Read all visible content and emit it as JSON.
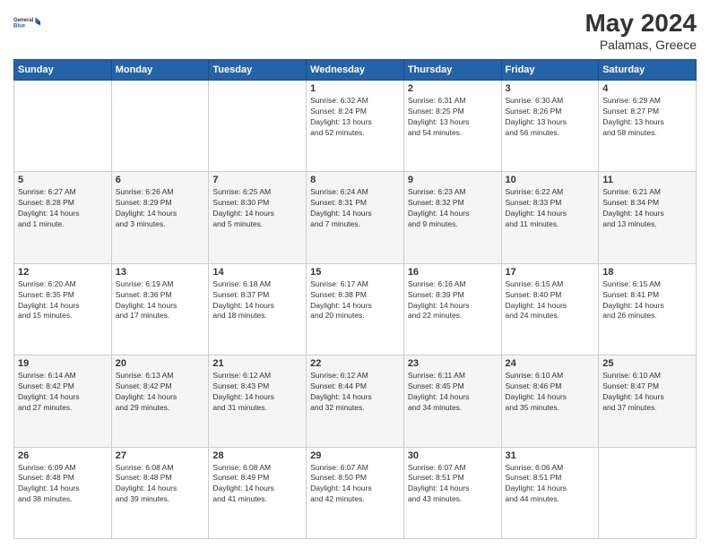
{
  "header": {
    "logo_line1": "General",
    "logo_line2": "Blue",
    "month_year": "May 2024",
    "location": "Palamas, Greece"
  },
  "weekdays": [
    "Sunday",
    "Monday",
    "Tuesday",
    "Wednesday",
    "Thursday",
    "Friday",
    "Saturday"
  ],
  "rows": [
    [
      {
        "day": "",
        "info": ""
      },
      {
        "day": "",
        "info": ""
      },
      {
        "day": "",
        "info": ""
      },
      {
        "day": "1",
        "info": "Sunrise: 6:32 AM\nSunset: 8:24 PM\nDaylight: 13 hours\nand 52 minutes."
      },
      {
        "day": "2",
        "info": "Sunrise: 6:31 AM\nSunset: 8:25 PM\nDaylight: 13 hours\nand 54 minutes."
      },
      {
        "day": "3",
        "info": "Sunrise: 6:30 AM\nSunset: 8:26 PM\nDaylight: 13 hours\nand 56 minutes."
      },
      {
        "day": "4",
        "info": "Sunrise: 6:29 AM\nSunset: 8:27 PM\nDaylight: 13 hours\nand 58 minutes."
      }
    ],
    [
      {
        "day": "5",
        "info": "Sunrise: 6:27 AM\nSunset: 8:28 PM\nDaylight: 14 hours\nand 1 minute."
      },
      {
        "day": "6",
        "info": "Sunrise: 6:26 AM\nSunset: 8:29 PM\nDaylight: 14 hours\nand 3 minutes."
      },
      {
        "day": "7",
        "info": "Sunrise: 6:25 AM\nSunset: 8:30 PM\nDaylight: 14 hours\nand 5 minutes."
      },
      {
        "day": "8",
        "info": "Sunrise: 6:24 AM\nSunset: 8:31 PM\nDaylight: 14 hours\nand 7 minutes."
      },
      {
        "day": "9",
        "info": "Sunrise: 6:23 AM\nSunset: 8:32 PM\nDaylight: 14 hours\nand 9 minutes."
      },
      {
        "day": "10",
        "info": "Sunrise: 6:22 AM\nSunset: 8:33 PM\nDaylight: 14 hours\nand 11 minutes."
      },
      {
        "day": "11",
        "info": "Sunrise: 6:21 AM\nSunset: 8:34 PM\nDaylight: 14 hours\nand 13 minutes."
      }
    ],
    [
      {
        "day": "12",
        "info": "Sunrise: 6:20 AM\nSunset: 8:35 PM\nDaylight: 14 hours\nand 15 minutes."
      },
      {
        "day": "13",
        "info": "Sunrise: 6:19 AM\nSunset: 8:36 PM\nDaylight: 14 hours\nand 17 minutes."
      },
      {
        "day": "14",
        "info": "Sunrise: 6:18 AM\nSunset: 8:37 PM\nDaylight: 14 hours\nand 18 minutes."
      },
      {
        "day": "15",
        "info": "Sunrise: 6:17 AM\nSunset: 8:38 PM\nDaylight: 14 hours\nand 20 minutes."
      },
      {
        "day": "16",
        "info": "Sunrise: 6:16 AM\nSunset: 8:39 PM\nDaylight: 14 hours\nand 22 minutes."
      },
      {
        "day": "17",
        "info": "Sunrise: 6:15 AM\nSunset: 8:40 PM\nDaylight: 14 hours\nand 24 minutes."
      },
      {
        "day": "18",
        "info": "Sunrise: 6:15 AM\nSunset: 8:41 PM\nDaylight: 14 hours\nand 26 minutes."
      }
    ],
    [
      {
        "day": "19",
        "info": "Sunrise: 6:14 AM\nSunset: 8:42 PM\nDaylight: 14 hours\nand 27 minutes."
      },
      {
        "day": "20",
        "info": "Sunrise: 6:13 AM\nSunset: 8:42 PM\nDaylight: 14 hours\nand 29 minutes."
      },
      {
        "day": "21",
        "info": "Sunrise: 6:12 AM\nSunset: 8:43 PM\nDaylight: 14 hours\nand 31 minutes."
      },
      {
        "day": "22",
        "info": "Sunrise: 6:12 AM\nSunset: 8:44 PM\nDaylight: 14 hours\nand 32 minutes."
      },
      {
        "day": "23",
        "info": "Sunrise: 6:11 AM\nSunset: 8:45 PM\nDaylight: 14 hours\nand 34 minutes."
      },
      {
        "day": "24",
        "info": "Sunrise: 6:10 AM\nSunset: 8:46 PM\nDaylight: 14 hours\nand 35 minutes."
      },
      {
        "day": "25",
        "info": "Sunrise: 6:10 AM\nSunset: 8:47 PM\nDaylight: 14 hours\nand 37 minutes."
      }
    ],
    [
      {
        "day": "26",
        "info": "Sunrise: 6:09 AM\nSunset: 8:48 PM\nDaylight: 14 hours\nand 38 minutes."
      },
      {
        "day": "27",
        "info": "Sunrise: 6:08 AM\nSunset: 8:48 PM\nDaylight: 14 hours\nand 39 minutes."
      },
      {
        "day": "28",
        "info": "Sunrise: 6:08 AM\nSunset: 8:49 PM\nDaylight: 14 hours\nand 41 minutes."
      },
      {
        "day": "29",
        "info": "Sunrise: 6:07 AM\nSunset: 8:50 PM\nDaylight: 14 hours\nand 42 minutes."
      },
      {
        "day": "30",
        "info": "Sunrise: 6:07 AM\nSunset: 8:51 PM\nDaylight: 14 hours\nand 43 minutes."
      },
      {
        "day": "31",
        "info": "Sunrise: 6:06 AM\nSunset: 8:51 PM\nDaylight: 14 hours\nand 44 minutes."
      },
      {
        "day": "",
        "info": ""
      }
    ]
  ]
}
